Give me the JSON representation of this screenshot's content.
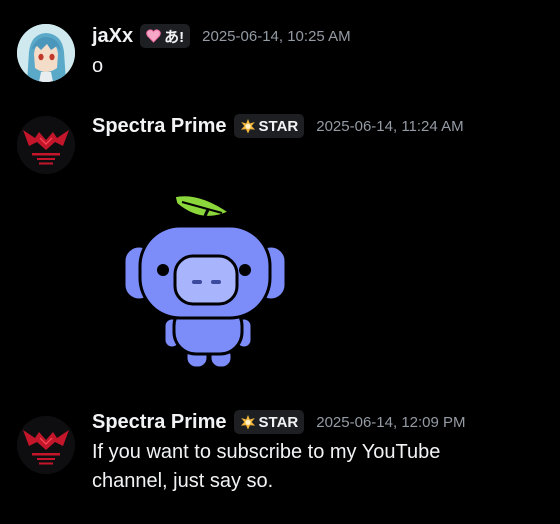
{
  "messages": [
    {
      "username": "jaXx",
      "tag_text": "あ!",
      "tag_icon": "pink-heart-icon",
      "timestamp": "2025-06-14, 10:25 AM",
      "content": "o"
    },
    {
      "username": "Spectra Prime",
      "tag_text": "STAR",
      "tag_icon": "star-burst-icon",
      "timestamp": "2025-06-14, 11:24 AM",
      "attachment": "wumpus-sticker"
    },
    {
      "username": "Spectra Prime",
      "tag_text": "STAR",
      "tag_icon": "star-burst-icon",
      "timestamp": "2025-06-14, 12:09 PM",
      "content": "If you want to subscribe to my YouTube channel, just say so."
    }
  ],
  "colors": {
    "background": "#000000",
    "text": "#f2f3f5",
    "timestamp": "#949ba4",
    "tag_background": "#1e1f22",
    "sticker_blue": "#7c8cf8",
    "sticker_leaf": "#8bd63a",
    "logo_red": "#c4162a"
  }
}
